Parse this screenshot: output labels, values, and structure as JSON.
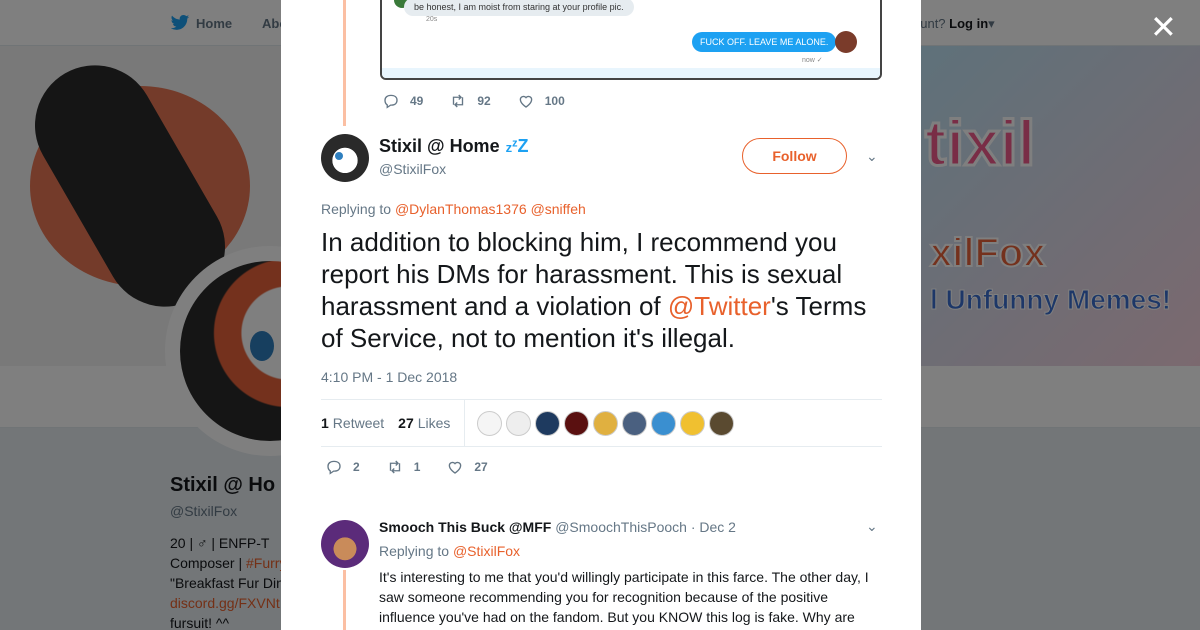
{
  "background": {
    "nav_home": "Home",
    "nav_about": "Abo",
    "nav_account_prompt": "ccount?",
    "nav_login": "Log in",
    "banner_title": "tixil",
    "banner_name": "xilFox",
    "banner_subtitle": "l Unfunny Memes!",
    "profile_name": "Stixil @ Ho",
    "profile_handle": "@StixilFox",
    "bio_line1_pre": "20 | ",
    "bio_line1_sym": "♂",
    "bio_line1_post": " | ENFP-T",
    "bio_line2_pre": "Composer | ",
    "bio_line2_tag": "#Furry",
    "bio_line3": "\"Breakfast Fur Din",
    "bio_line4_link": "discord.gg/FXVNt",
    "bio_line5": "fursuit! ^^"
  },
  "close_label": "✕",
  "dm_screenshot": {
    "incoming": "be honest, I am moist from staring at your profile pic.",
    "incoming_time": "20s",
    "outgoing": "FUCK OFF.  LEAVE ME ALONE.",
    "outgoing_time": "now ✓"
  },
  "prev_actions": {
    "replies": "49",
    "retweets": "92",
    "likes": "100"
  },
  "tweet": {
    "author_name": "Stixil @ Home",
    "author_handle": "@StixilFox",
    "follow_label": "Follow",
    "replying_label": "Replying to",
    "replying_user1": "@DylanThomas1376",
    "replying_user2": "@sniffeh",
    "text_pre": "In addition to blocking him, I recommend you report his DMs for harassment. This is sexual harassment and a violation of ",
    "text_mention": "@Twitter",
    "text_post": "'s Terms of Service, not to mention it's illegal.",
    "timestamp": "4:10 PM - 1 Dec 2018",
    "retweet_count": "1",
    "retweet_label": "Retweet",
    "like_count": "27",
    "like_label": "Likes",
    "actions": {
      "replies": "2",
      "retweets": "1",
      "likes": "27"
    }
  },
  "likers_colors": [
    "#f5f5f5",
    "#eeeeee",
    "#1e3a5f",
    "#5a1010",
    "#e0b040",
    "#4a6080",
    "#3a8fd0",
    "#f0c030",
    "#5a4a30"
  ],
  "reply": {
    "name": "Smooch This Buck @MFF",
    "handle": "@SmoochThisPooch",
    "date": "· Dec 2",
    "replying_label": "Replying to",
    "replying_user": "@StixilFox",
    "text": "It's interesting to me that you'd willingly participate in this farce. The other day, I saw someone recommending you for recognition because of the positive influence you've had on the fandom. But you KNOW this log is fake. Why are you using it to raise shit like this?"
  },
  "colors": {
    "accent": "#e8612c",
    "twitter_blue": "#1da1f2"
  }
}
